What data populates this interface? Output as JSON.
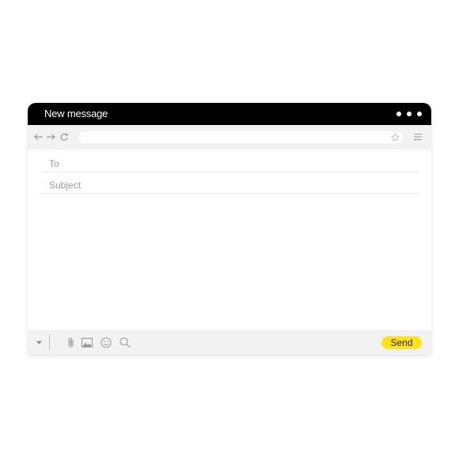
{
  "window": {
    "title": "New message"
  },
  "navbar": {
    "url_value": ""
  },
  "compose": {
    "to_placeholder": "To",
    "subject_placeholder": "Subject"
  },
  "toolbar": {
    "send_label": "Send"
  },
  "colors": {
    "titlebar": "#000000",
    "send_button": "#ffe21a",
    "bars": "#f2f2f2"
  },
  "icons": [
    "menu-dots-icon",
    "back-arrow-icon",
    "forward-arrow-icon",
    "reload-icon",
    "star-icon",
    "hamburger-menu-icon",
    "dropdown-caret-icon",
    "attachment-icon",
    "image-icon",
    "emoji-icon",
    "search-icon"
  ]
}
